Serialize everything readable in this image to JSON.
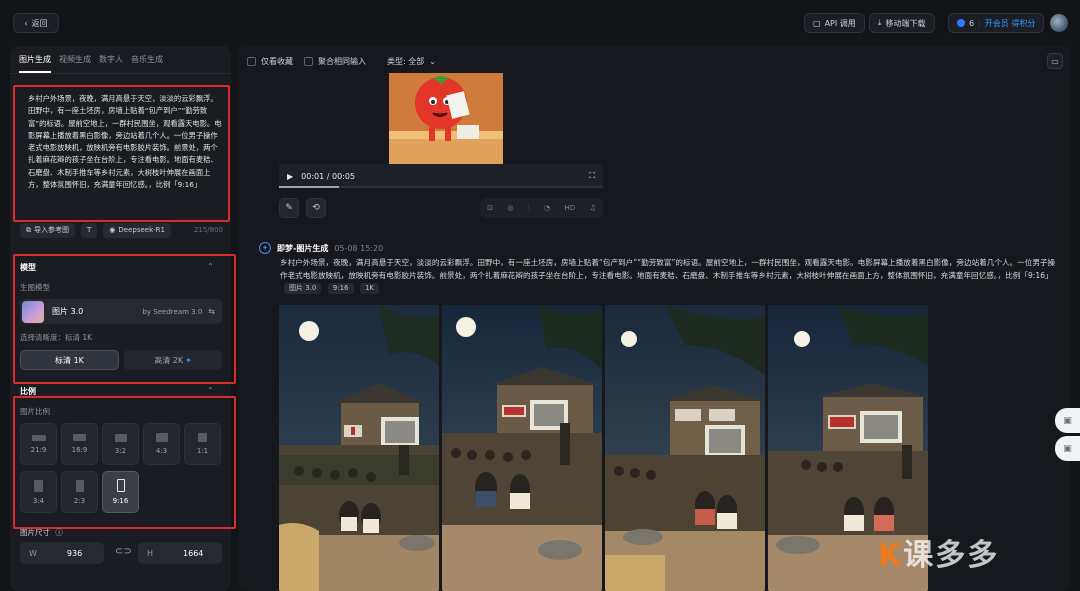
{
  "topbar": {
    "back_label": "返回",
    "api_label": "API 调用",
    "mobile_label": "移动端下载",
    "credits": "6",
    "vip_label": "开会员 得积分"
  },
  "left": {
    "tabs": [
      "图片生成",
      "视频生成",
      "数字人",
      "音乐生成"
    ],
    "prompt": "乡村户外场景，夜晚，满月高悬于天空，淡淡的云彩飘浮。田野中，有一座土坯房，房墙上贴着“包产到户”“勤劳致富”的标语。屋前空地上，一群村民围坐，观看露天电影。电影屏幕上播放着黑白影像，旁边站着几个人。一位男子操作老式电影放映机，放映机旁有电影胶片装饰。前景处，两个扎着麻花辫的孩子坐在台阶上，专注看电影。地面有麦秸、石磨盘、木制手推车等乡村元素，大树枝叶伸展在画面上方，整体氛围怀旧，充满童年回忆感。，比例「9:16」",
    "import_ref": "导入参考图",
    "prompt_model": "Deepseek-R1",
    "counter": "215/800",
    "model_section": {
      "title": "模型",
      "sub": "生图模型",
      "model_name": "图片 3.0",
      "model_by": "by Seedream 3.0",
      "clarity_label": "选择清晰度：标清 1K",
      "std_label": "标清 1K",
      "hd_label": "高清 2K",
      "hd_plus": "✦"
    },
    "ratio_section": {
      "title": "比例",
      "sub": "图片比例",
      "ratios": [
        "21:9",
        "16:9",
        "3:2",
        "4:3",
        "1:1",
        "3:4",
        "2:3",
        "9:16"
      ],
      "selected": "9:16"
    },
    "size_section": {
      "title": "图片尺寸",
      "w_key": "W",
      "w_value": "936",
      "h_key": "H",
      "h_value": "1664"
    }
  },
  "main": {
    "filters": {
      "fav_label": "仅看收藏",
      "merge_label": "聚合相同输入",
      "type_label": "类型: 全部"
    },
    "video": {
      "time": "00:01 / 00:05"
    },
    "media_tools": [
      "HD"
    ],
    "generation": {
      "name": "即梦-图片生成",
      "date": "05-08  15:20",
      "prompt": "乡村户外场景，夜晚，满月高悬于天空，淡淡的云彩飘浮。田野中，有一座土坯房，房墙上贴着“包产到户”“勤劳致富”的标语。屋前空地上，一群村民围坐，观看露天电影。电影屏幕上播放着黑白影像，旁边站着几个人。一位男子操作老式电影放映机，放映机旁有电影胶片装饰。前景处，两个扎着麻花辫的孩子坐在台阶上，专注看电影。地面有麦秸、石磨盘、木制手推车等乡村元素，大树枝叶伸展在画面上方，整体氛围怀旧，充满童年回忆感。，比例「9:16」",
      "tags": [
        "图片 3.0",
        "9:16",
        "1K"
      ]
    },
    "image_signs": [
      "包产到户",
      "勤劳致富"
    ]
  },
  "colors": {
    "accent": "#2f7bff",
    "highlight_red": "#d92b2b",
    "watermark_orange": "#f07a1a"
  },
  "watermark": {
    "brand": "课多多"
  }
}
